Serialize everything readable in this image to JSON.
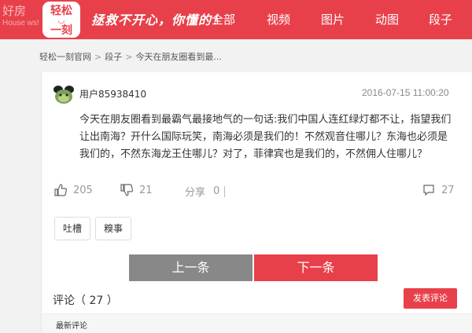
{
  "watermark": {
    "line1": "好房",
    "line2": "House  ws!"
  },
  "header": {
    "logo": {
      "top": "轻松",
      "bottom": "一刻"
    },
    "slogan": "拯救不开心，你懂的！",
    "nav": [
      "全部",
      "视频",
      "图片",
      "动图",
      "段子"
    ]
  },
  "breadcrumb": {
    "home": "轻松一刻官网",
    "category": "段子",
    "current": "今天在朋友圈看到最..."
  },
  "post": {
    "username": "用户85938410",
    "timestamp": "2016-07-15 11:00:20",
    "content": "今天在朋友圈看到最霸气最接地气的一句话:我们中国人连红绿灯都不让，指望我们让出南海？开什么国际玩笑，南海必须是我们的！不然观音住哪儿？东海也必须是我们的，不然东海龙王住哪儿？对了，菲律宾也是我们的，不然佣人住哪儿？",
    "likes": "205",
    "dislikes": "21",
    "share_label": "分享",
    "shares": "0",
    "comment_count": "27",
    "tags": [
      "吐槽",
      "糗事"
    ]
  },
  "pager": {
    "prev": "上一条",
    "next": "下一条"
  },
  "comments": {
    "header": "评论（ 27 ）",
    "post_button": "发表评论",
    "latest_label": "最新评论"
  },
  "colors": {
    "brand": "#e8404a",
    "prev_button": "#888888"
  }
}
